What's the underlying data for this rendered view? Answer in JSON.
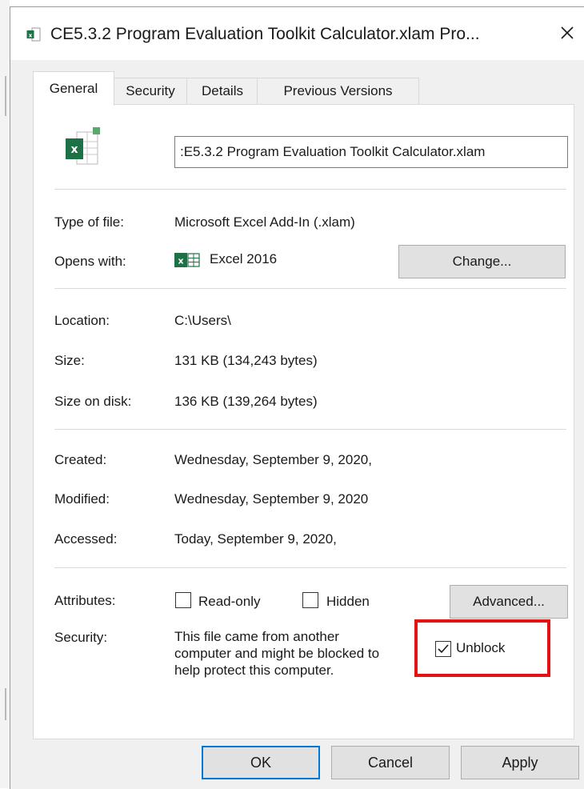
{
  "window": {
    "title": "CE5.3.2 Program Evaluation Toolkit Calculator.xlam Pro...",
    "close_glyph": "✕"
  },
  "tabs": [
    {
      "label": "General",
      "active": true
    },
    {
      "label": "Security",
      "active": false
    },
    {
      "label": "Details",
      "active": false
    },
    {
      "label": "Previous Versions",
      "active": false
    }
  ],
  "general": {
    "file_name_value": ":E5.3.2 Program Evaluation Toolkit Calculator.xlam",
    "type_label": "Type of file:",
    "type_value": "Microsoft Excel Add-In (.xlam)",
    "opens_label": "Opens with:",
    "opens_value": "Excel 2016",
    "change_button": "Change...",
    "location_label": "Location:",
    "location_value": "C:\\Users\\",
    "size_label": "Size:",
    "size_value": "131 KB (134,243 bytes)",
    "size_disk_label": "Size on disk:",
    "size_disk_value": "136 KB (139,264 bytes)",
    "created_label": "Created:",
    "created_value": "Wednesday, September 9, 2020,",
    "modified_label": "Modified:",
    "modified_value": "Wednesday, September 9, 2020",
    "accessed_label": "Accessed:",
    "accessed_value": "Today, September 9, 2020,",
    "attributes_label": "Attributes:",
    "readonly_label": "Read-only",
    "readonly_checked": false,
    "hidden_label": "Hidden",
    "hidden_checked": false,
    "advanced_button": "Advanced...",
    "security_label": "Security:",
    "security_line1": "This file came from another",
    "security_line2": "computer and might be blocked to",
    "security_line3": "help protect this computer.",
    "unblock_label": "Unblock",
    "unblock_checked": true
  },
  "buttons": {
    "ok": "OK",
    "cancel": "Cancel",
    "apply": "Apply"
  },
  "colors": {
    "excel_green": "#1e7145",
    "highlight_red": "#e41212",
    "default_button_border": "#0078d7"
  },
  "icons": {
    "title": "excel-file-icon",
    "file": "excel-file-icon",
    "opens_with": "excel-app-icon",
    "close": "close-icon",
    "checkmark": "checkmark-icon"
  }
}
